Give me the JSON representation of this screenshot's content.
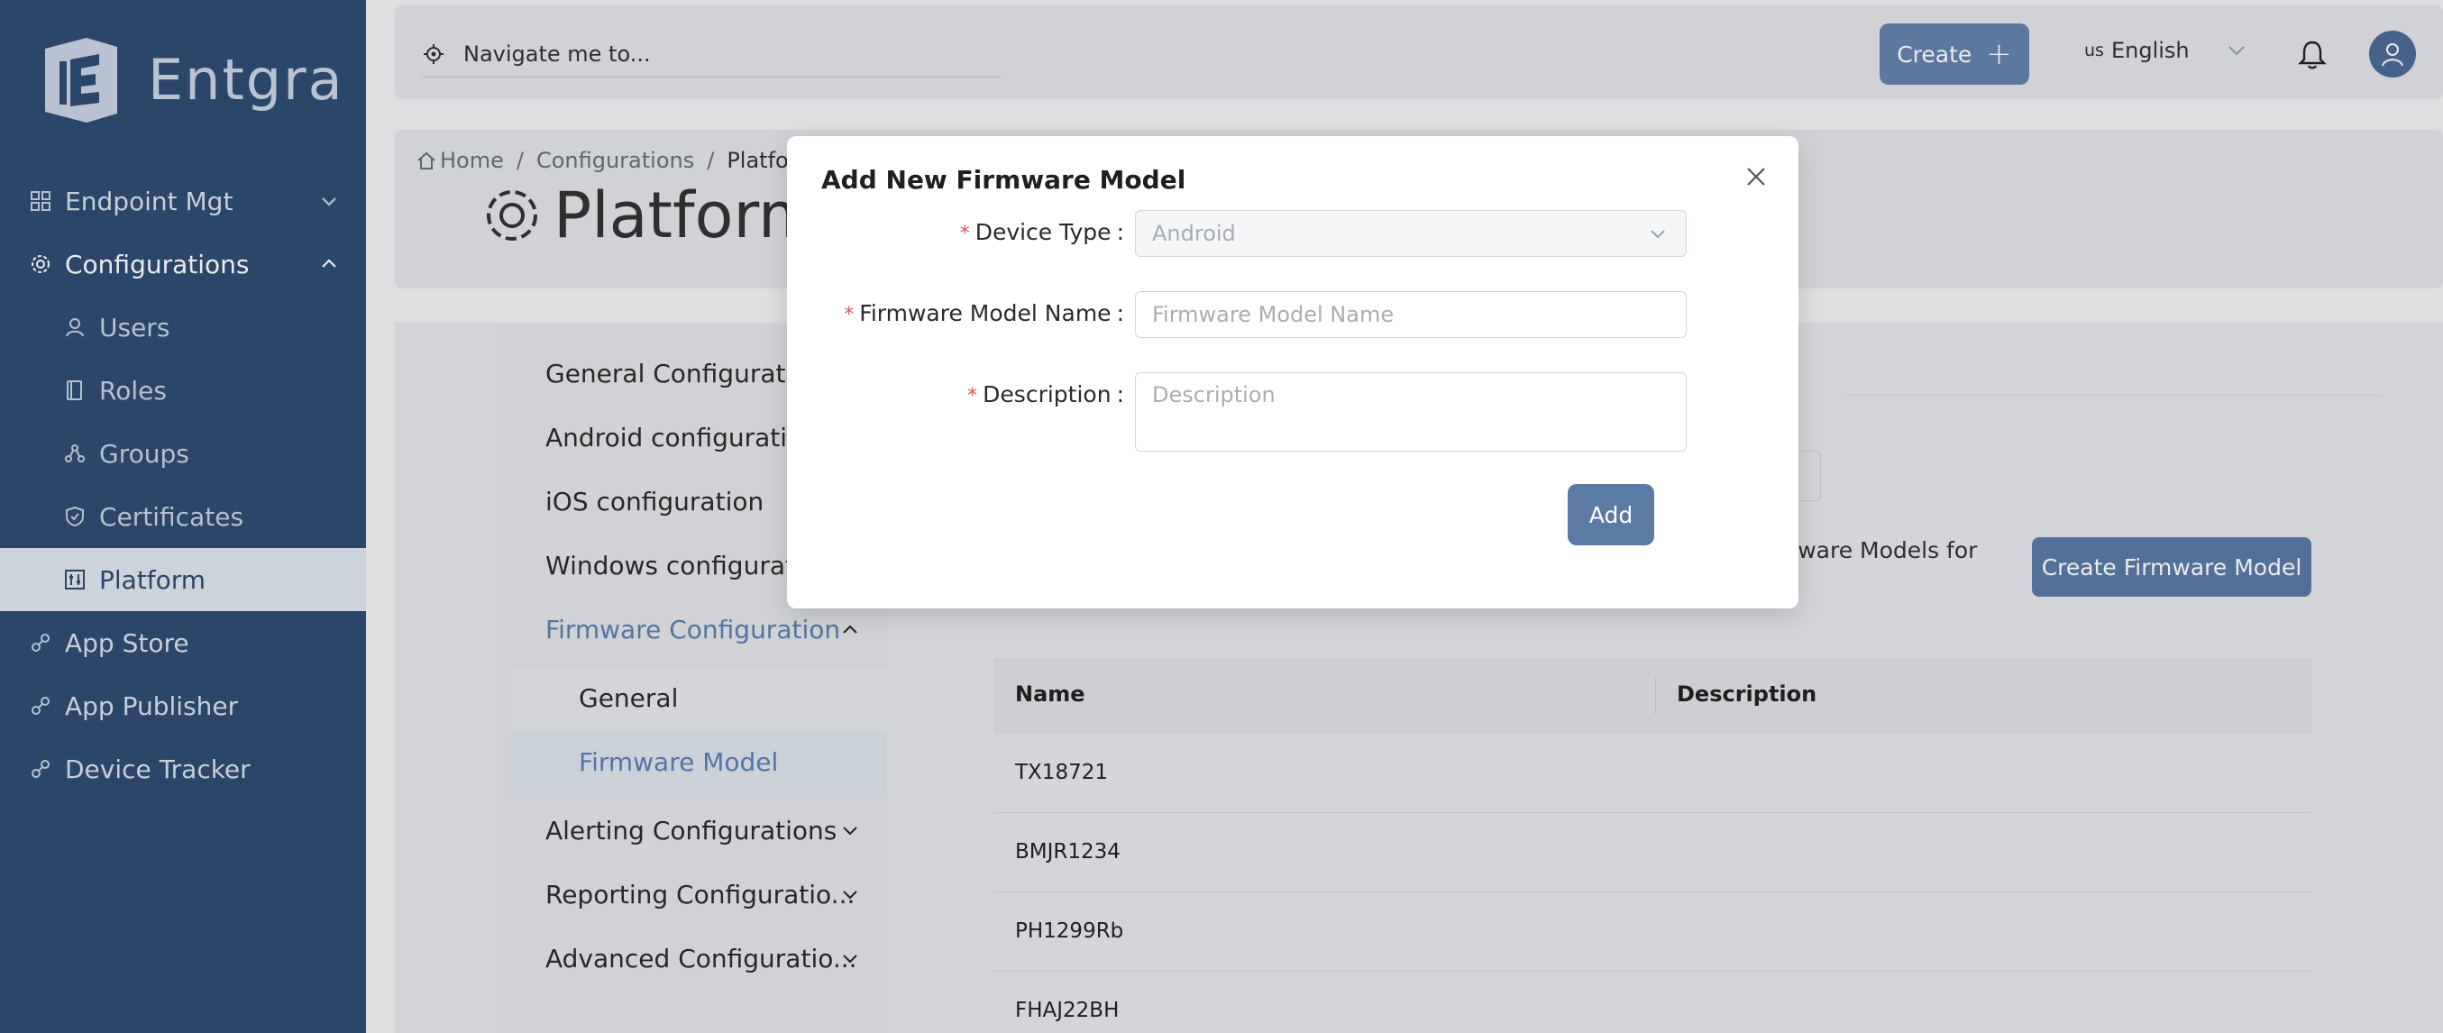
{
  "brand": {
    "name": "Entgra"
  },
  "sidebar": {
    "items": [
      {
        "label": "Endpoint Mgt",
        "icon": "grid-icon"
      },
      {
        "label": "Configurations",
        "icon": "gear-icon"
      },
      {
        "label": "Users",
        "icon": "user-icon"
      },
      {
        "label": "Roles",
        "icon": "book-icon"
      },
      {
        "label": "Groups",
        "icon": "group-icon"
      },
      {
        "label": "Certificates",
        "icon": "shield-icon"
      },
      {
        "label": "Platform",
        "icon": "sliders-icon"
      },
      {
        "label": "App Store",
        "icon": "link-icon"
      },
      {
        "label": "App Publisher",
        "icon": "link-icon"
      },
      {
        "label": "Device Tracker",
        "icon": "link-icon"
      }
    ]
  },
  "topbar": {
    "search_placeholder": "Navigate me to...",
    "create_label": "Create",
    "language_flag": "us",
    "language_label": "English"
  },
  "breadcrumb": {
    "home": "Home",
    "configurations": "Configurations",
    "current": "Platform"
  },
  "page": {
    "title": "Platform"
  },
  "config_menu": {
    "items": [
      "General Configuration",
      "Android configuration",
      "iOS configuration",
      "Windows configuration",
      "Firmware Configuration",
      "General",
      "Firmware Model",
      "Alerting Configurations",
      "Reporting Configuratio...",
      "Advanced Configuratio..."
    ]
  },
  "firmware": {
    "info_text": "rmware Models for",
    "create_button": "Create Firmware Model",
    "table": {
      "columns": [
        "Name",
        "Description"
      ],
      "rows": [
        {
          "name": "TX18721"
        },
        {
          "name": "BMJR1234"
        },
        {
          "name": "PH1299Rb"
        },
        {
          "name": "FHAJ22BH"
        }
      ]
    }
  },
  "modal": {
    "title": "Add New Firmware Model",
    "device_type_label": "Device Type",
    "device_type_value": "Android",
    "name_label": "Firmware Model Name",
    "name_placeholder": "Firmware Model Name",
    "description_label": "Description",
    "description_placeholder": "Description",
    "add_label": "Add"
  },
  "colors": {
    "sidebar": "#2f4c72",
    "accent": "#5b7ba5",
    "required": "#e0555a"
  }
}
